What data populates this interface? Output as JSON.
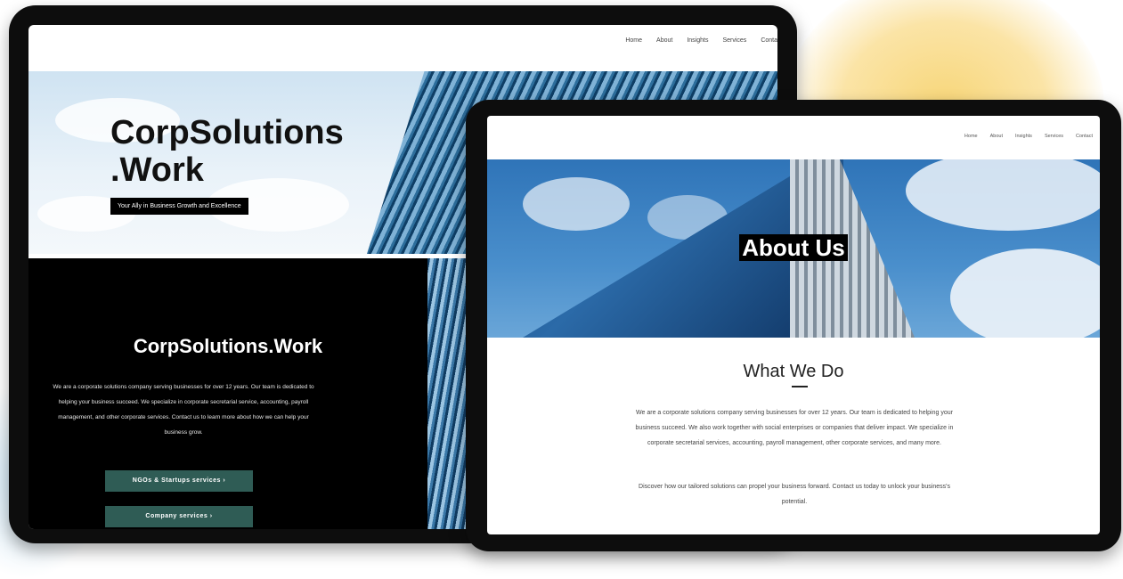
{
  "back_site": {
    "nav": [
      "Home",
      "About",
      "Insights",
      "Services",
      "Conta"
    ],
    "brand_line1": "CorpSolutions",
    "brand_line2": ".Work",
    "tagline": "Your Ally in Business Growth and Excellence",
    "section_title": "CorpSolutions.Work",
    "description": "We are a corporate solutions company serving businesses for over 12 years. Our team is dedicated to helping your business succeed. We specialize in corporate secretarial service, accounting, payroll management, and other corporate services. Contact us to learn more about how we can help your business grow.",
    "buttons": [
      "NGOs & Startups services ›",
      "Company services ›"
    ]
  },
  "front_site": {
    "nav": [
      "Home",
      "About",
      "Insights",
      "Services",
      "Contact"
    ],
    "hero_title": "About Us",
    "section_title": "What We Do",
    "paragraph1": "We are a corporate solutions company serving businesses for over 12 years. Our team is dedicated to helping your business succeed. We also work together with social enterprises or companies that deliver impact. We specialize in corporate secretarial services, accounting, payroll management, other corporate services, and many more.",
    "paragraph2": "Discover how our tailored solutions can propel your business forward. Contact us today to unlock your business's potential."
  }
}
